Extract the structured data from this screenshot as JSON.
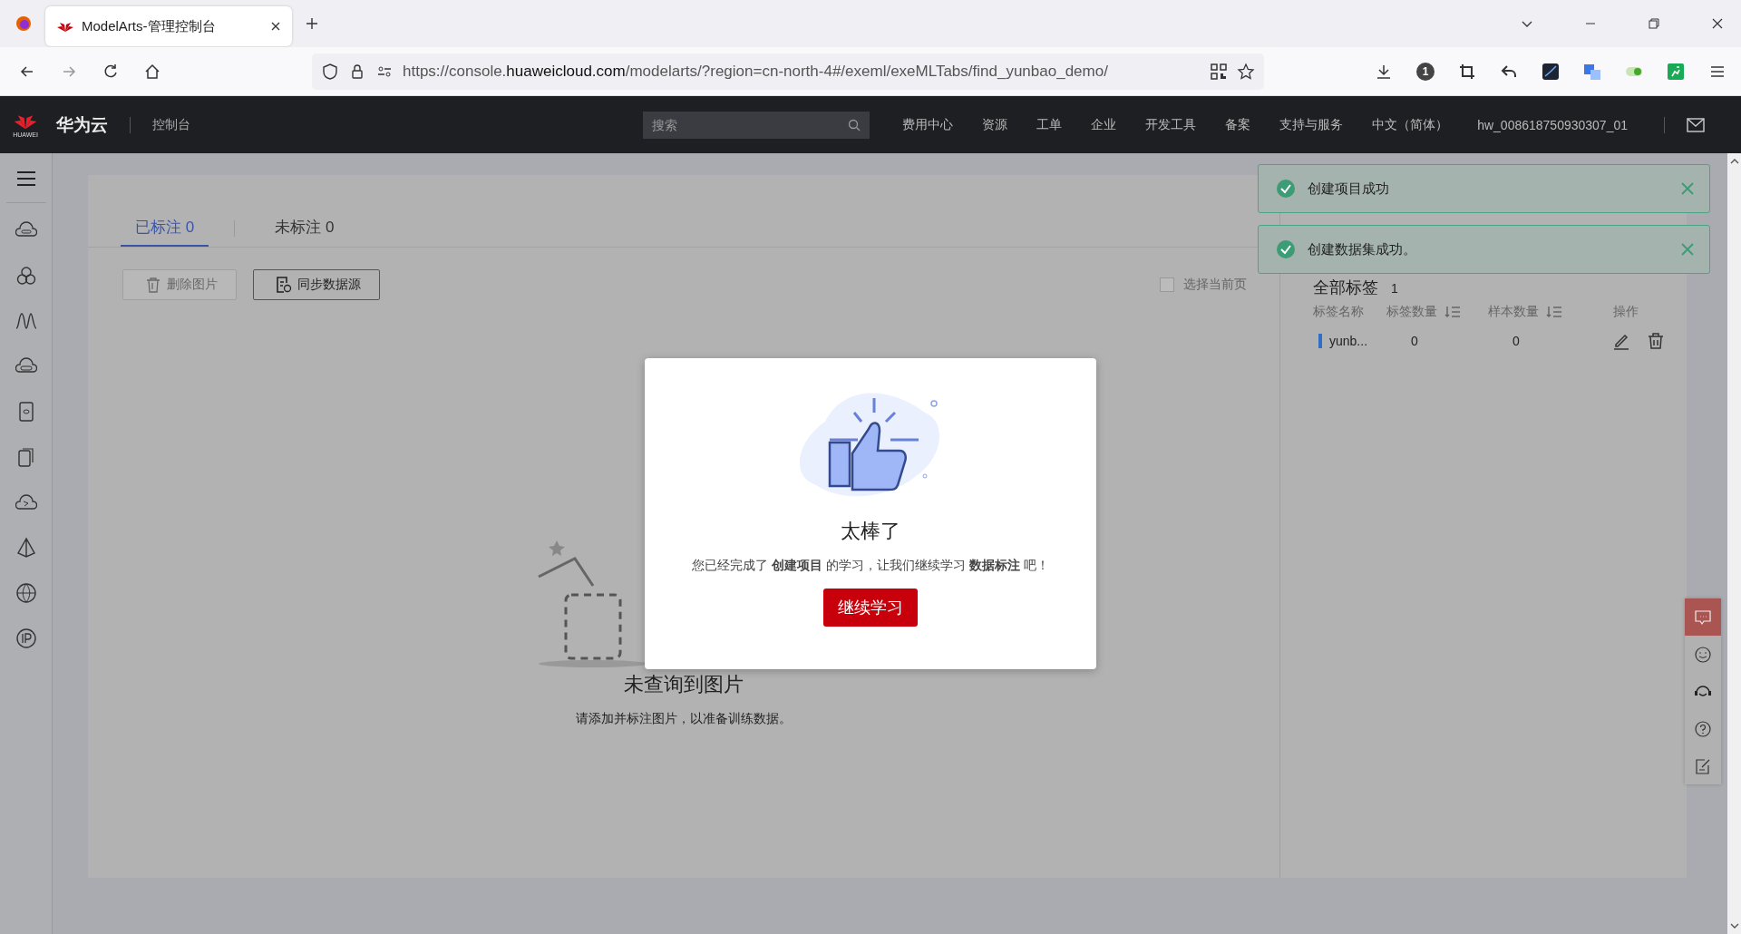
{
  "browser": {
    "tab_title": "ModelArts-管理控制台",
    "url": {
      "prefix": "https://console.",
      "host": "huaweicloud.com",
      "path": "/modelarts/?region=cn-north-4#/exeml/exeMLTabs/find_yunbao_demo/"
    },
    "badge": "1"
  },
  "header": {
    "logo_text": "HUAWEI",
    "brand": "华为云",
    "console": "控制台",
    "search": {
      "placeholder": "搜索"
    },
    "nav": [
      "费用中心",
      "资源",
      "工单",
      "企业",
      "开发工具",
      "备案",
      "支持与服务",
      "中文（简体）",
      "hw_008618750930307_01"
    ]
  },
  "tabs": [
    {
      "label": "已标注 0",
      "selected": true
    },
    {
      "label": "未标注 0",
      "selected": false
    }
  ],
  "toolbar": [
    {
      "kind": "delete",
      "label": "删除图片",
      "disabled": true
    },
    {
      "kind": "sync",
      "label": "同步数据源",
      "disabled": false
    }
  ],
  "select_page": {
    "label": "选择当前页",
    "checked": false
  },
  "empty": {
    "title": "未查询到图片",
    "hint": "请添加并标注图片，以准备训练数据。"
  },
  "labels_panel": {
    "title": "全部标签",
    "count": "1",
    "columns": [
      "标签名称",
      "标签数量",
      "样本数量",
      "操作"
    ],
    "rows": [
      {
        "name": "yunb...",
        "label_count": "0",
        "sample_count": "0"
      }
    ]
  },
  "toasts": [
    {
      "text": "创建项目成功"
    },
    {
      "text": "创建数据集成功。"
    }
  ],
  "modal": {
    "title": "太棒了",
    "message": "您已经完成了 **创建项目** 的学习，让我们继续学习 **数据标注** 吧！",
    "button": "继续学习"
  }
}
